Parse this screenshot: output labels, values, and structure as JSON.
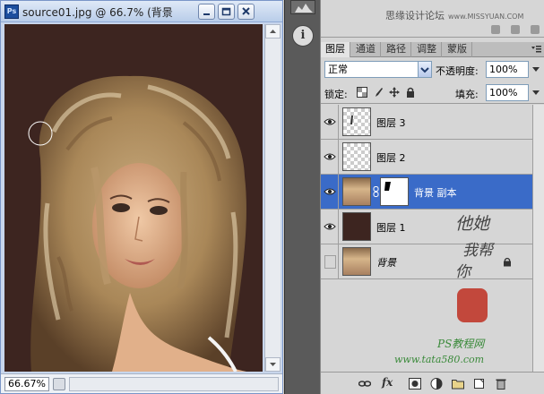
{
  "document": {
    "title": "source01.jpg @ 66.7% (背景",
    "zoom": "66.67%"
  },
  "panel": {
    "watermark": "思缘设计论坛",
    "watermark_site": "www.MISSYUAN.COM",
    "tabs": [
      {
        "label": "图层",
        "active": true
      },
      {
        "label": "通道",
        "active": false
      },
      {
        "label": "路径",
        "active": false
      },
      {
        "label": "调整",
        "active": false
      },
      {
        "label": "蒙版",
        "active": false
      }
    ],
    "blend_mode": "正常",
    "opacity_label": "不透明度:",
    "opacity_value": "100%",
    "lock_label": "锁定:",
    "fill_label": "填充:",
    "fill_value": "100%",
    "layers": [
      {
        "name": "图层 3",
        "visible": true,
        "selected": false,
        "thumb": "checker"
      },
      {
        "name": "图层 2",
        "visible": true,
        "selected": false,
        "thumb": "checker"
      },
      {
        "name": "背景 副本",
        "visible": true,
        "selected": true,
        "thumb": "photo",
        "mask": true
      },
      {
        "name": "图层 1",
        "visible": true,
        "selected": false,
        "thumb": "brown"
      },
      {
        "name": "背景",
        "visible": false,
        "selected": false,
        "thumb": "photo",
        "locked": true
      }
    ]
  },
  "decor": {
    "calligraphy_1": "他她",
    "calligraphy_2": "我帮",
    "calligraphy_3": "你",
    "credit_1": "PS教程网",
    "credit_2": "www.tata580.com"
  },
  "colors": {
    "canvas_bg": "#3d2520",
    "selection": "#3a6bc8"
  }
}
